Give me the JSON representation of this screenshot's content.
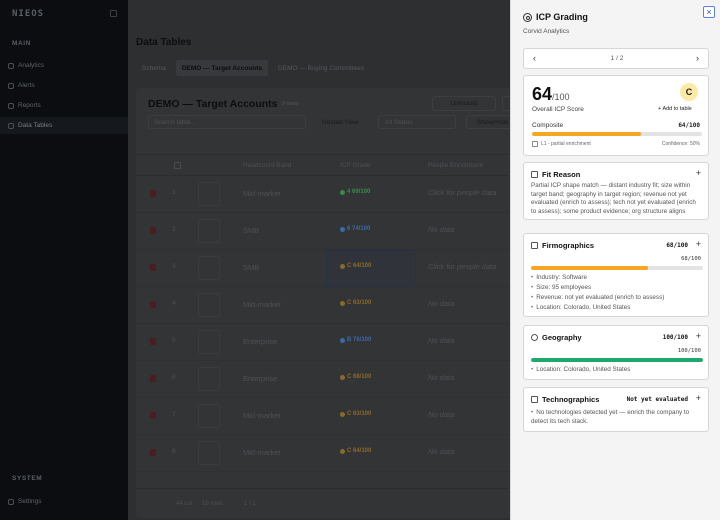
{
  "sidebar": {
    "logo": "NIEOS",
    "main_label": "MAIN",
    "items": [
      {
        "label": "Analytics",
        "icon": "chart-icon"
      },
      {
        "label": "Alerts",
        "icon": "bell-icon"
      },
      {
        "label": "Reports",
        "icon": "report-icon"
      },
      {
        "label": "Data Tables",
        "icon": "table-icon",
        "active": true
      }
    ],
    "system_label": "SYSTEM",
    "settings_label": "Settings"
  },
  "main": {
    "title": "Data Tables",
    "subtabs": [
      {
        "label": "Schema",
        "active": false
      },
      {
        "label": "DEMO — Target Accounts",
        "active": true
      },
      {
        "label": "DEMO — Buying Committees",
        "active": false
      }
    ],
    "table_title": "DEMO — Target Accounts",
    "meta": "9 rows",
    "unlocked_label": "Unlocked",
    "search_placeholder": "Search table...",
    "nested_label": "Nested View",
    "status_label": "All Status",
    "show_label": "Show/Hide",
    "columns": [
      "Headcount Band",
      "ICP Grade",
      "People Enrichment"
    ],
    "rows": [
      {
        "num": "1",
        "band": "Mid-market",
        "score": "4 69/100",
        "score_color": "#3a8a4a",
        "people": "Click for people data"
      },
      {
        "num": "2",
        "band": "SMB",
        "score": "6 74/100",
        "score_color": "#3a6aa8",
        "people": "No data"
      },
      {
        "num": "3",
        "band": "SMB",
        "score": "C 64/100",
        "score_color": "#8a6a2a",
        "people": "Click for people data",
        "selected": true
      },
      {
        "num": "4",
        "band": "Mid-market",
        "score": "C 63/100",
        "score_color": "#8a6a2a",
        "people": "No data"
      },
      {
        "num": "5",
        "band": "Enterprise",
        "score": "B 76/100",
        "score_color": "#3a6aa8",
        "people": "No data"
      },
      {
        "num": "6",
        "band": "Enterprise",
        "score": "C 68/100",
        "score_color": "#8a6a2a",
        "people": "No data"
      },
      {
        "num": "7",
        "band": "Mid-market",
        "score": "C 63/100",
        "score_color": "#8a6a2a",
        "people": "No data"
      },
      {
        "num": "8",
        "band": "Mid-market",
        "score": "C 64/100",
        "score_color": "#8a6a2a",
        "people": "No data"
      }
    ],
    "footer": {
      "cols": "44 col",
      "rows": "10 rows",
      "page": "1 / 1"
    }
  },
  "panel": {
    "title": "ICP Grading",
    "company": "Corvid Analytics",
    "pager": "1 / 2",
    "score": "64",
    "score_den": "/100",
    "score_label": "Overall ICP Score",
    "grade": "C",
    "add_to_table": "Add to table",
    "composite_label": "Composite",
    "composite_value": "64/100",
    "composite_pct": 64,
    "enrichment_label": "L1 - partial enrichment",
    "confidence": "Confidence: 50%",
    "fit_reason": {
      "title": "Fit Reason",
      "text": "Partial ICP shape match — distant industry fit; size within target band; geography in target region; revenue not yet evaluated (enrich to assess); tech not yet evaluated (enrich to assess); some product evidence; org structure aligns"
    },
    "firmographics": {
      "title": "Firmographics",
      "value": "68/100",
      "sub": "68/100",
      "pct": 68,
      "bullets": [
        "Industry: Software",
        "Size: 95 employees",
        "Revenue: not yet evaluated (enrich to assess)",
        "Location: Colorado, United States"
      ]
    },
    "geography": {
      "title": "Geography",
      "value": "100/100",
      "sub": "100/100",
      "pct": 100,
      "bullets": [
        "Location: Colorado, United States"
      ]
    },
    "technographics": {
      "title": "Technographics",
      "value": "Not yet evaluated",
      "bullets": [
        "No technologies detected yet — enrich the company to detect its tech stack."
      ]
    }
  },
  "colors": {
    "orange": "#f5a623",
    "green": "#1fa86b",
    "accent_blue": "#2b4fa8"
  }
}
